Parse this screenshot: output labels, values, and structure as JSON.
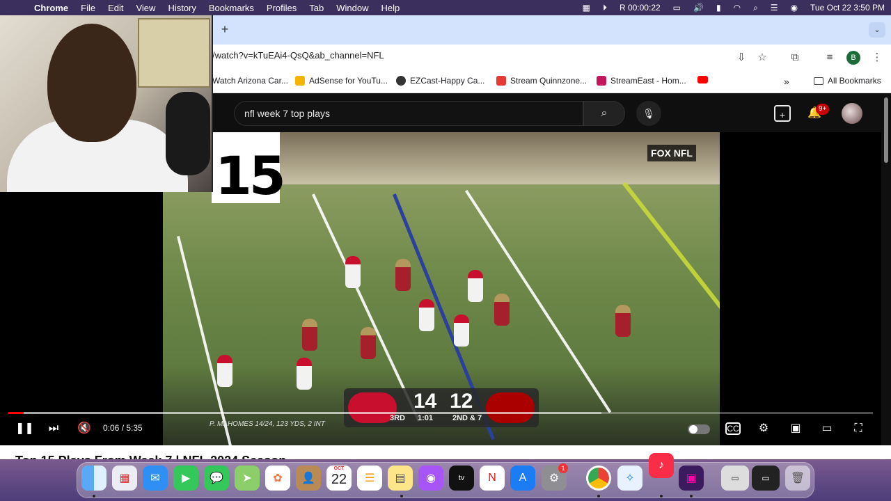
{
  "menubar": {
    "app_name": "Chrome",
    "menus": [
      "File",
      "Edit",
      "View",
      "History",
      "Bookmarks",
      "Profiles",
      "Tab",
      "Window",
      "Help"
    ],
    "recording_timer": "R 00:00:22",
    "datetime": "Tue Oct 22  3:50 PM"
  },
  "browser": {
    "url": "/watch?v=kTuEAi4-QsQ&ab_channel=NFL",
    "profile_initial": "B",
    "bookmarks": [
      {
        "label": "Watch Arizona Car...",
        "color": "#ffffff"
      },
      {
        "label": "AdSense for YouTu...",
        "color": "#f4b400"
      },
      {
        "label": "EZCast-Happy Ca...",
        "color": "#333333"
      },
      {
        "label": "Stream Quinnzone...",
        "color": "#e53935"
      },
      {
        "label": "StreamEast - Hom...",
        "color": "#c2185b"
      },
      {
        "label": "",
        "color": "#ff0000"
      }
    ],
    "overflow_label": "»",
    "all_bookmarks_label": "All Bookmarks"
  },
  "youtube": {
    "search_query": "nfl week 7 top plays",
    "notification_count": "9+",
    "video_title": "Top 15 Plays From Week 7 | NFL 2024 Season"
  },
  "video_frame": {
    "rank": "15",
    "network": "FOX NFL",
    "score_left": "14",
    "score_right": "12",
    "quarter": "3RD",
    "clock": "1:01",
    "down": "2ND & 7",
    "stat_line": "P. MAHOMES 14/24, 123 YDS, 2 INT"
  },
  "player": {
    "time_display": "0:06 / 5:35",
    "played_fraction": 0.018,
    "buffered_fraction": 0.686
  },
  "dock": {
    "calendar_month": "OCT",
    "calendar_day": "22",
    "settings_badge": "1"
  }
}
